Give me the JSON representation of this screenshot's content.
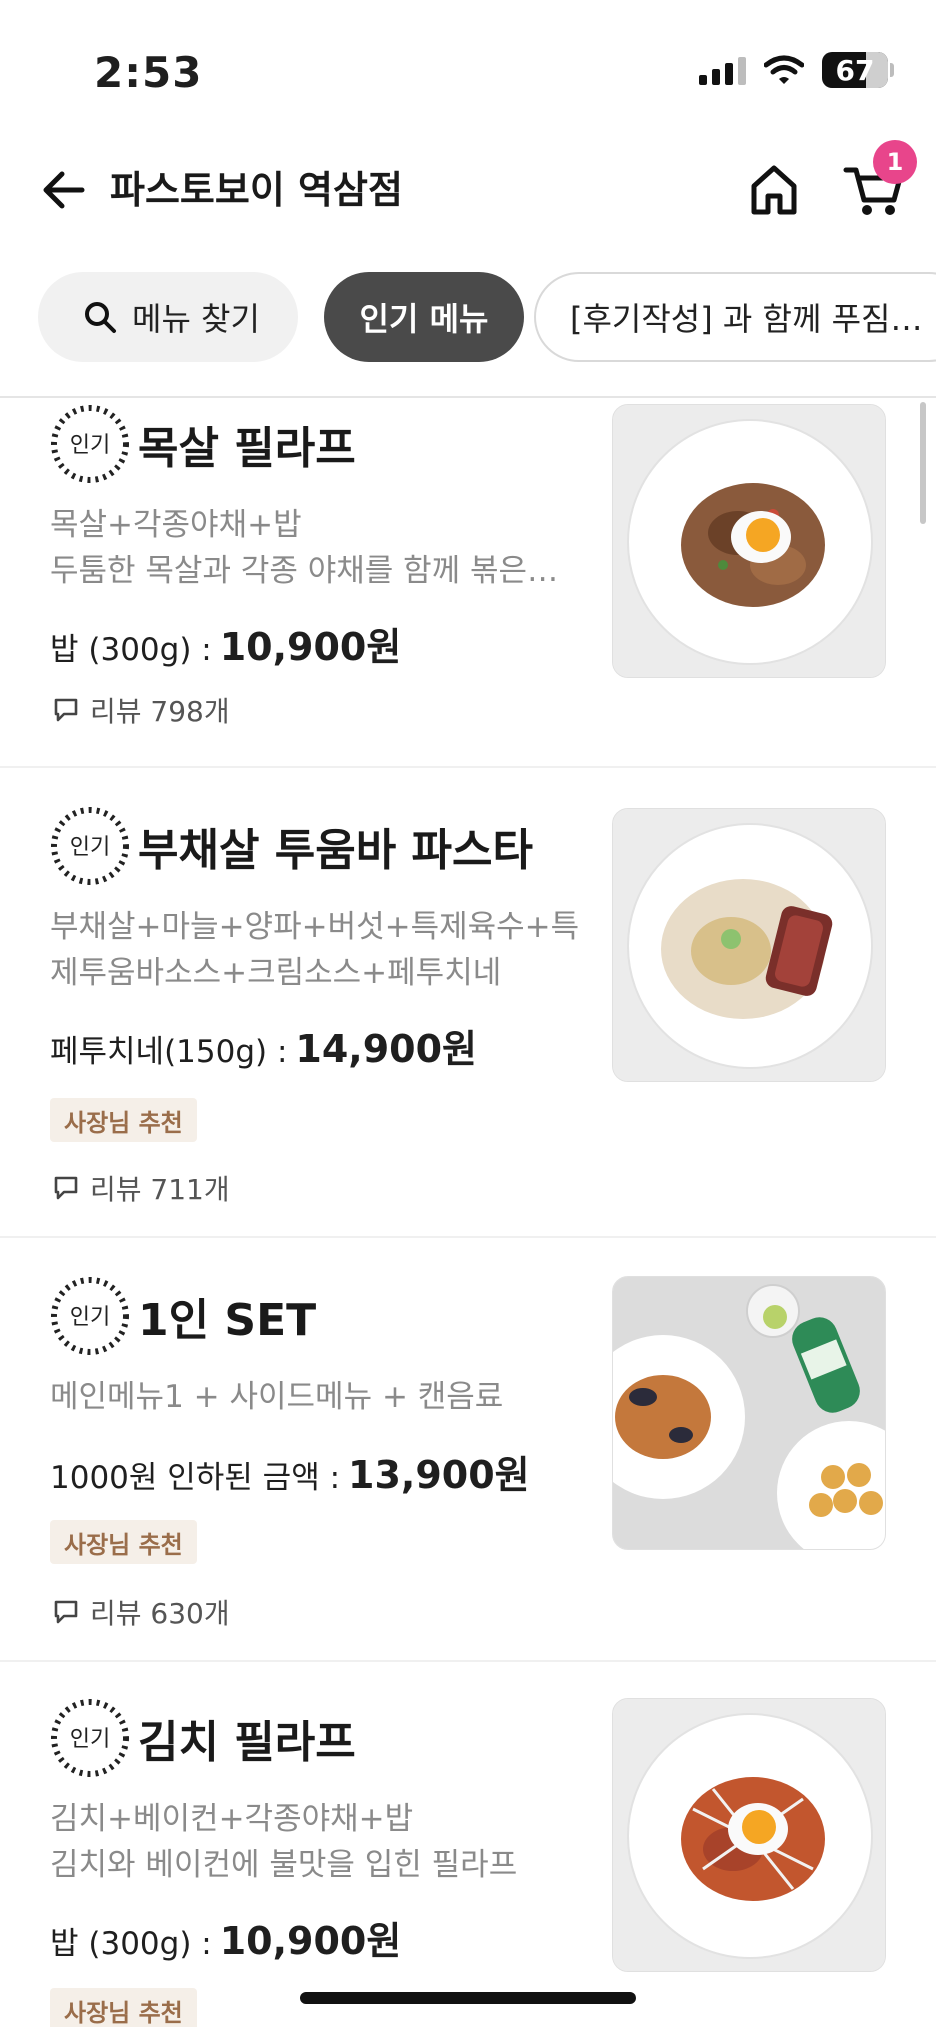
{
  "status": {
    "time": "2:53",
    "battery": "67"
  },
  "header": {
    "title": "파스토보이 역삼점",
    "cart_count": "1"
  },
  "chips": {
    "search": "메뉴 찾기",
    "popular": "인기 메뉴",
    "review_event": "[후기작성] 과 함께 푸짐…"
  },
  "badge_label": "인기",
  "menu": [
    {
      "name": "목살 필라프",
      "desc": [
        "목살+각종야채+밥",
        "두툼한 목살과 각종 야채를 함께 볶은…"
      ],
      "price_label": "밥 (300g) :",
      "price": "10,900원",
      "owner_tag": "",
      "reviews": "리뷰 798개"
    },
    {
      "name": "부채살 투움바 파스타",
      "desc": [
        "부채살+마늘+양파+버섯+특제육수+특",
        "제투움바소스+크림소스+페투치네"
      ],
      "price_label": "페투치네(150g) :",
      "price": "14,900원",
      "owner_tag": "사장님 추천",
      "reviews": "리뷰 711개"
    },
    {
      "name": "1인 SET",
      "desc": [
        "메인메뉴1 + 사이드메뉴 + 캔음료"
      ],
      "price_label": "1000원 인하된 금액 :",
      "price": "13,900원",
      "owner_tag": "사장님 추천",
      "reviews": "리뷰 630개"
    },
    {
      "name": "김치 필라프",
      "desc": [
        "김치+베이컨+각종야채+밥",
        "김치와 베이컨에 불맛을 입힌 필라프"
      ],
      "price_label": "밥 (300g) :",
      "price": "10,900원",
      "owner_tag": "사장님 추천",
      "reviews": ""
    }
  ],
  "colors": {
    "accent_badge": "#e8458b",
    "chip_active": "#4a4a4a",
    "owner_tag_bg": "#f5efe8",
    "owner_tag_text": "#9a6d4a"
  }
}
